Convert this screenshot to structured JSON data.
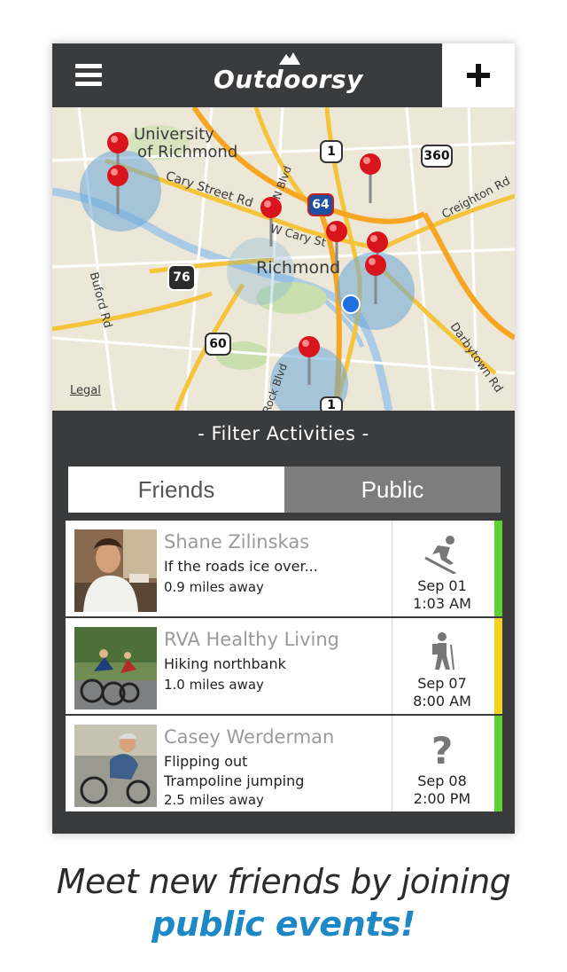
{
  "app": {
    "title": "Outdoorsy"
  },
  "map": {
    "labels": {
      "university": "University",
      "of_richmond": "of Richmond",
      "cary_street": "Cary Street Rd",
      "w_cary": "W Cary St",
      "richmond": "Richmond",
      "buford": "Buford Rd",
      "creighton": "Creighton Rd",
      "darbytown": "Darbytown Rd",
      "boulevard": "N Blvd",
      "rock_blvd": "Rock Blvd",
      "legal": "Legal"
    },
    "shields": {
      "r1": "1",
      "r360": "360",
      "r64": "64",
      "r76": "76",
      "r60": "60",
      "r1b": "1"
    }
  },
  "filter": {
    "title": "- Filter Activities -",
    "tabs": [
      {
        "label": "Friends"
      },
      {
        "label": "Public"
      }
    ],
    "selected": "Public"
  },
  "activities": [
    {
      "name": "Shane Zilinskas",
      "desc": [
        "If the roads ice over..."
      ],
      "distance": "0.9 miles away",
      "date": "Sep 01",
      "time": "1:03 AM",
      "icon": "skiing-icon",
      "status_color": "#5fd233"
    },
    {
      "name": "RVA Healthy Living",
      "desc": [
        "Hiking northbank"
      ],
      "distance": "1.0 miles away",
      "date": "Sep 07",
      "time": "8:00 AM",
      "icon": "hiking-icon",
      "status_color": "#f2d21c"
    },
    {
      "name": "Casey Werderman",
      "desc": [
        "Flipping out",
        "Trampoline jumping"
      ],
      "distance": "2.5 miles away",
      "date": "Sep 08",
      "time": "2:00 PM",
      "icon": "question-mark-icon",
      "status_color": "#5fd233"
    }
  ],
  "tagline": {
    "line1": "Meet new friends by joining",
    "line2": "public events!"
  },
  "colors": {
    "dark": "#3a3b3d",
    "accent_blue": "#1e88c7",
    "pin_red": "#d8141c"
  }
}
